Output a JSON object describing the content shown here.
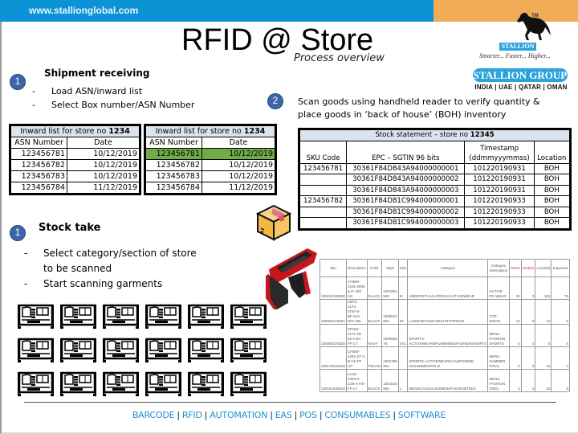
{
  "header": {
    "url": "www.stallionglobal.com",
    "title": "RFID @ Store",
    "subtitle": "Process overview",
    "bar_color": "#0a93d5",
    "accent_color": "#efab55"
  },
  "logo": {
    "trademark": "TM",
    "brand": "STALLION",
    "tagline": "Smarter... Faster... Higher...",
    "group": "STALLION GROUP",
    "countries": "INDIA | UAE | QATAR | OMAN"
  },
  "step1": {
    "number": "1",
    "heading": "Shipment receiving",
    "bullets": [
      "Load ASN/inward list",
      "Select Box number/ASN Number"
    ]
  },
  "inward_tables": [
    {
      "title_prefix": "Inward list for store no ",
      "store_no": "1234",
      "columns": [
        "ASN Number",
        "Date"
      ],
      "rows": [
        [
          "123456781",
          "10/12/2019"
        ],
        [
          "123456782",
          "10/12/2019"
        ],
        [
          "123456783",
          "10/12/2019"
        ],
        [
          "123456784",
          "11/12/2019"
        ]
      ],
      "highlighted_row": null
    },
    {
      "title_prefix": "Inward list for store no ",
      "store_no": "1234",
      "columns": [
        "ASN Number",
        "Date"
      ],
      "rows": [
        [
          "123456781",
          "10/12/2019"
        ],
        [
          "123456782",
          "10/12/2019"
        ],
        [
          "123456783",
          "10/12/2019"
        ],
        [
          "123456784",
          "11/12/2019"
        ]
      ],
      "highlighted_row": 0,
      "highlight_color": "#70ad47"
    }
  ],
  "step2": {
    "number": "2",
    "text_line1": "Scan goods using handheld reader to verify quantity &",
    "text_line2": "place goods in ‘back of house’ (BOH) inventory"
  },
  "stock_table": {
    "title_prefix": "Stock statement – store no ",
    "store_no": "12345",
    "columns": [
      "SKU Code",
      "EPC – SGTIN 96 bits",
      "Timestamp",
      "(ddmmyyymmss)",
      "Location"
    ],
    "rows": [
      [
        "123456781",
        "30361F84D843A94000000001",
        "101220190931",
        "BOH"
      ],
      [
        "",
        "30361F84D843A94000000002",
        "101220190931",
        "BOH"
      ],
      [
        "",
        "30361F84D843A94000000003",
        "101220190931",
        "BOH"
      ],
      [
        "123456782",
        "30361F84D81C994000000001",
        "101220190933",
        "BOH"
      ],
      [
        "",
        "30361F84D81C994000000002",
        "101220190933",
        "BOH"
      ],
      [
        "",
        "30361F84D81C994000000003",
        "101220190933",
        "BOH"
      ]
    ]
  },
  "step3": {
    "number": "1",
    "heading": "Stock take",
    "bullets": [
      "Select category/section of store to be scanned",
      "Start scanning garments"
    ],
    "bullet1_line1": "Select category/section of store",
    "bullet1_line2": "to be scanned"
  },
  "count_table": {
    "columns": [
      "Sku",
      "Description",
      "Color",
      "Style",
      "Size",
      "Category",
      "Category Description",
      "Overs",
      "Unders",
      "Counted",
      "Expected"
    ],
    "rows": [
      [
        "100190180200",
        "ATIBW-2191-0005 & FI 250 AG",
        "BLACK",
        "1001901 550",
        "M",
        "UNDERSTHAN ATERSACUTI DEWEAR",
        "ACTIVE PG WEAR",
        "20",
        "0",
        "102",
        "78"
      ],
      [
        "100061134602",
        "LBFS-1173-0797-6-BF-5L6-SHI-ABL",
        "BLACK",
        "1000612 663",
        "00",
        "LADIESETHNICSRSHITTOPWAR",
        "TOP WEAR",
        "12",
        "0",
        "12",
        "0"
      ],
      [
        "100060276302",
        "SPSW-4171-0H 02 A EH FF CT",
        "NAVY",
        "1000602 76",
        "XXL",
        "SPORTS-ACTIVEWEARSPUNNMENSFASHIONSHORTS",
        "MENS FASHION SHORTS",
        "5",
        "0",
        "5",
        "0"
      ],
      [
        "100179625402",
        "CHBW-4281-ST 0 B HS FF CP",
        "PEACH",
        "1001796 254",
        "",
        "SPORTS-ACTIVEWEARCHAMPIONME NSSUMMERPOLO",
        "MENS SUMMER POLO",
        "6",
        "0",
        "10",
        "4"
      ],
      [
        "100151840002",
        "LU15-4250-0-C28-A-HS-FF-LY",
        "BLACK",
        "1001518 550",
        "L",
        "MENSCASUALISOMENSFASHIONTEES",
        "MENS FASHION TEES",
        "5",
        "0",
        "10",
        "5"
      ]
    ]
  },
  "icons": {
    "box": "cardboard-box-icon",
    "reader": "rfid-handheld-reader-icon",
    "rack": "clothing-rack-icon",
    "rack_count": 18
  },
  "footer": {
    "links": [
      "BARCODE",
      "RFID",
      "AUTOMATION",
      "EAS",
      "POS",
      "CONSUMABLES",
      "SOFTWARE"
    ],
    "link_color": "#1e92c9"
  }
}
